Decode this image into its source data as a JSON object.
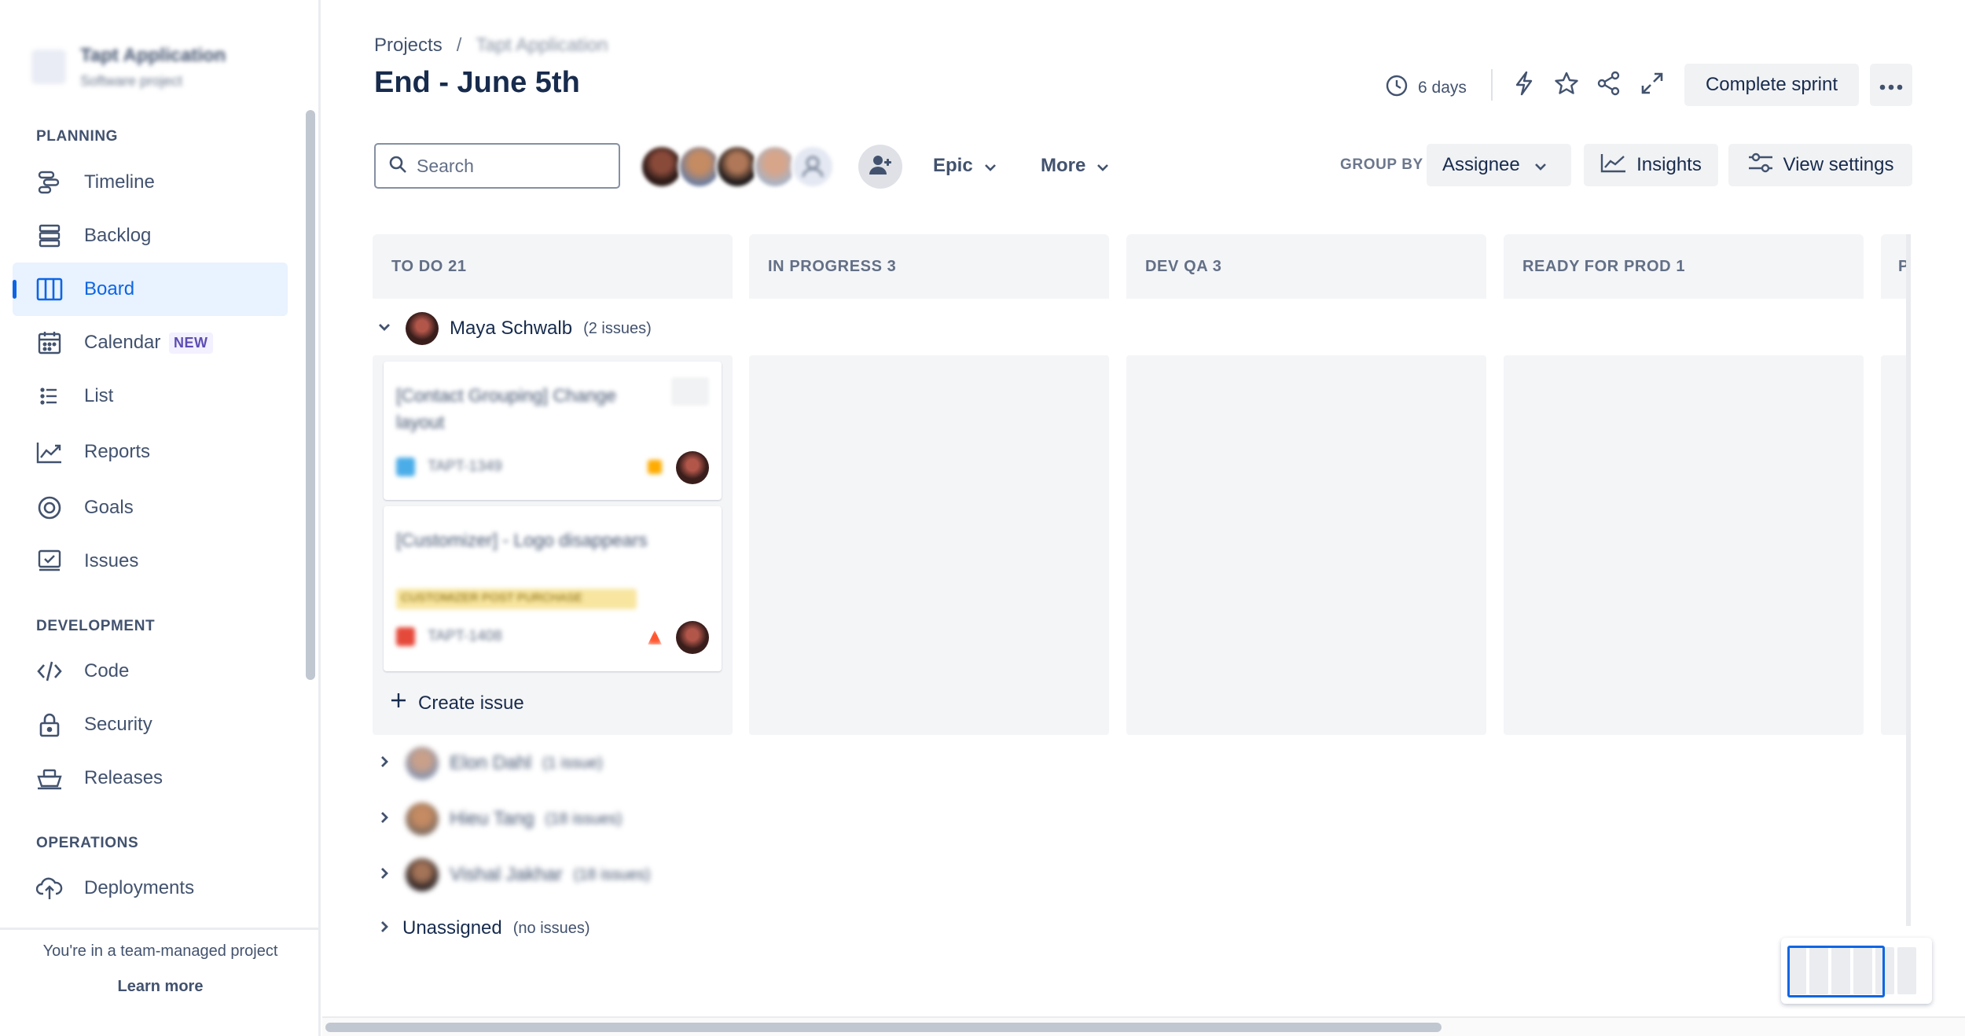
{
  "sidebar": {
    "project_name": "Tapt Application",
    "project_type": "Software project",
    "sections": [
      {
        "title": "PLANNING"
      },
      {
        "title": "DEVELOPMENT"
      },
      {
        "title": "OPERATIONS"
      }
    ],
    "items": [
      {
        "label": "Timeline",
        "icon": "timeline-icon"
      },
      {
        "label": "Backlog",
        "icon": "backlog-icon"
      },
      {
        "label": "Board",
        "icon": "board-icon",
        "active": true
      },
      {
        "label": "Calendar",
        "icon": "calendar-icon",
        "badge": "NEW"
      },
      {
        "label": "List",
        "icon": "list-icon"
      },
      {
        "label": "Reports",
        "icon": "reports-icon"
      },
      {
        "label": "Goals",
        "icon": "goals-icon"
      },
      {
        "label": "Issues",
        "icon": "issues-icon"
      },
      {
        "label": "Code",
        "icon": "code-icon"
      },
      {
        "label": "Security",
        "icon": "lock-icon"
      },
      {
        "label": "Releases",
        "icon": "ship-icon"
      },
      {
        "label": "Deployments",
        "icon": "cloud-upload-icon"
      }
    ],
    "footer": {
      "note": "You're in a team-managed project",
      "link": "Learn more"
    }
  },
  "header": {
    "breadcrumb": [
      "Projects",
      "/",
      "Tapt Application"
    ],
    "title": "End - June 5th",
    "days_remaining": "6 days",
    "complete_sprint_label": "Complete sprint",
    "more_icon": "ellipsis-icon"
  },
  "toolbar": {
    "search_placeholder": "Search",
    "epic_label": "Epic",
    "more_label": "More",
    "group_by_label": "GROUP BY",
    "group_by_value": "Assignee",
    "insights_label": "Insights",
    "view_settings_label": "View settings"
  },
  "board": {
    "columns": [
      {
        "title": "TO DO 21"
      },
      {
        "title": "IN PROGRESS 3"
      },
      {
        "title": "DEV QA 3"
      },
      {
        "title": "READY FOR PROD 1"
      },
      {
        "title": "P"
      }
    ],
    "swimlanes": [
      {
        "name": "Maya Schwalb",
        "count": "(2 issues)",
        "expanded": true
      },
      {
        "name": "Elon Dahl",
        "count": "(1 issue)"
      },
      {
        "name": "Hieu Tang",
        "count": "(18 issues)"
      },
      {
        "name": "Vishal Jakhar",
        "count": "(18 issues)"
      },
      {
        "name": "Unassigned",
        "count": "(no issues)"
      }
    ],
    "cards": [
      {
        "title": "[Contact Grouping] Change layout",
        "key": "TAPT-1349",
        "type_color": "#4bade8",
        "priority_color": "#ffab00"
      },
      {
        "title": "[Customizer] - Logo disappears",
        "key": "TAPT-1408",
        "label": "CUSTOMIZER POST PURCHASE",
        "type_color": "#e5493a",
        "priority_color": "#ff5630"
      }
    ],
    "create_issue_label": "Create issue"
  },
  "colors": {
    "accent": "#0c66e4",
    "text": "#172b4d",
    "column_bg": "#f4f5f7"
  }
}
